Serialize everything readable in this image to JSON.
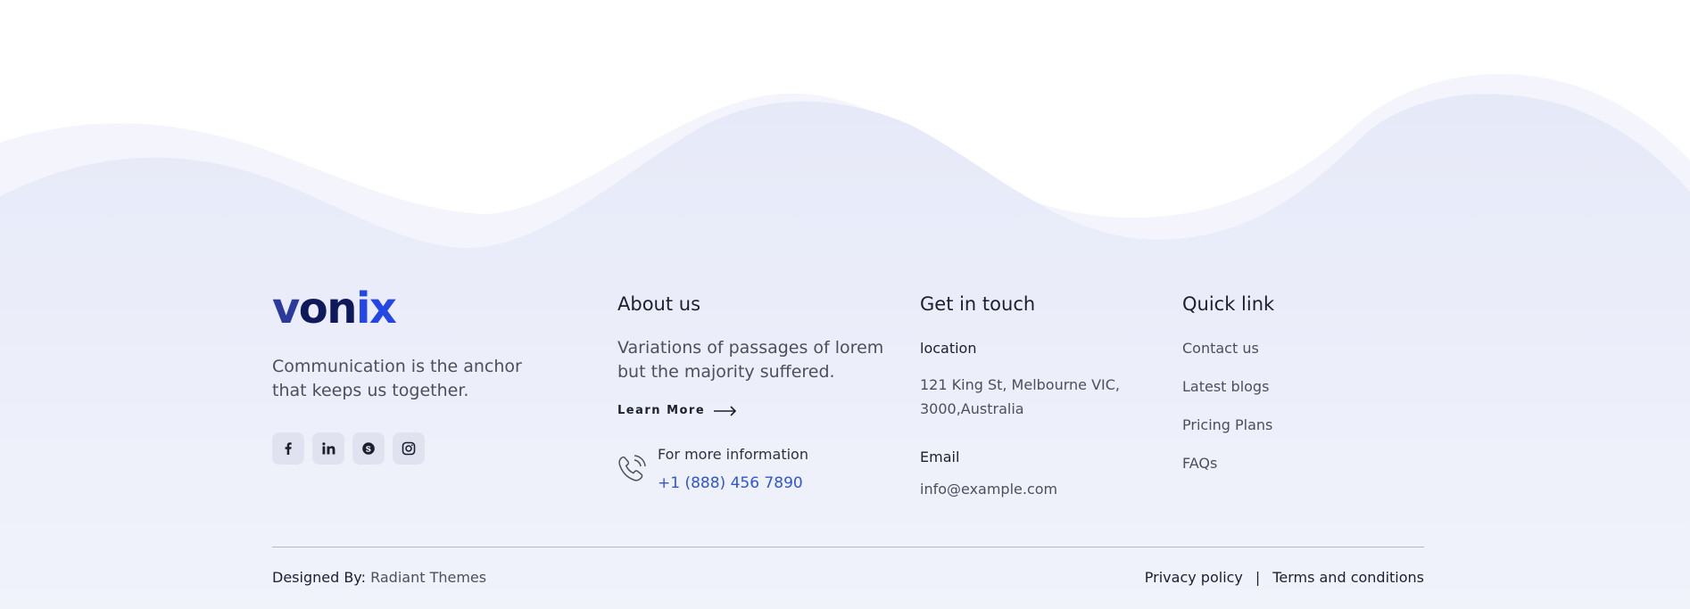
{
  "logo": {
    "part1": "v",
    "part2": "on",
    "part3": "ix"
  },
  "brand_col": {
    "tagline": "Communication is the anchor that keeps us together.",
    "socials": [
      {
        "icon": "facebook-icon"
      },
      {
        "icon": "linkedin-icon"
      },
      {
        "icon": "skype-icon"
      },
      {
        "icon": "instagram-icon"
      }
    ]
  },
  "about": {
    "title": "About us",
    "text": "Variations of passages of lorem but the majority suffered.",
    "learn_more": "Learn More",
    "more_info_label": "For more information",
    "phone": "+1 (888) 456 7890"
  },
  "contact": {
    "title": "Get in touch",
    "location_label": "location",
    "address": "121 King St, Melbourne VIC, 3000,Australia",
    "email_label": "Email",
    "email": "info@example.com"
  },
  "quick": {
    "title": "Quick link",
    "links": [
      "Contact us",
      "Latest blogs",
      "Pricing Plans",
      "FAQs"
    ]
  },
  "bottom": {
    "designed_prefix": "Designed By:",
    "designed_brand": "Radiant Themes",
    "privacy": "Privacy policy",
    "separator": "|",
    "terms": "Terms and conditions"
  },
  "colors": {
    "accent": "#2f55d4",
    "wave_light": "#eceffa",
    "logo_dark": "#0f1a5c"
  }
}
